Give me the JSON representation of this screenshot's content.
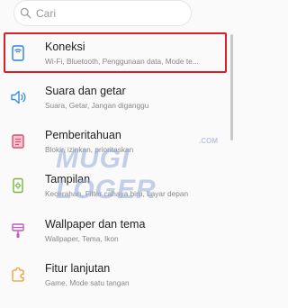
{
  "search": {
    "placeholder": "Cari"
  },
  "items": [
    {
      "title": "Koneksi",
      "subtitle": "Wi-Fi, Bluetooth, Penggunaan data, Mode te...",
      "icon": "connections-icon",
      "color": "#2e7fd6"
    },
    {
      "title": "Suara dan getar",
      "subtitle": "Suara, Getar, Jangan diganggu",
      "icon": "sound-icon",
      "color": "#3b8ee6"
    },
    {
      "title": "Pemberitahuan",
      "subtitle": "Blokir, izinkan, prioritaskan",
      "icon": "notifications-icon",
      "color": "#e04a6e"
    },
    {
      "title": "Tampilan",
      "subtitle": "Kecerahan, Filter cahaya biru, Layar depan",
      "icon": "display-icon",
      "color": "#7cb342"
    },
    {
      "title": "Wallpaper dan tema",
      "subtitle": "Wallpaper, Tema, Ikon",
      "icon": "wallpaper-icon",
      "color": "#c158c9"
    },
    {
      "title": "Fitur lanjutan",
      "subtitle": "Game, Mode satu tangan",
      "icon": "advanced-features-icon",
      "color": "#f09a2c"
    }
  ],
  "watermark": {
    "main": "MUGI LOGER",
    "suffix": ".COM"
  },
  "colors": {
    "highlight": "#d9202a"
  }
}
